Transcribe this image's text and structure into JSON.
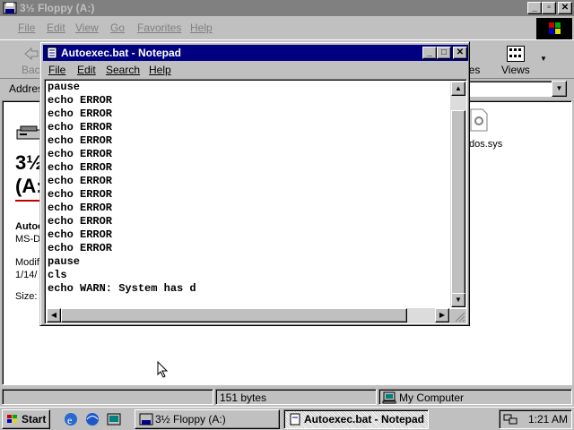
{
  "explorer": {
    "title": "3½ Floppy (A:)",
    "menu": [
      "File",
      "Edit",
      "View",
      "Go",
      "Favorites",
      "Help"
    ],
    "toolbar": {
      "back_label": "Back",
      "partial_label": "ies",
      "views_label": "Views"
    },
    "address_label": "Address",
    "content": {
      "title_line1": "3½ Floppy",
      "title_line2": "(A:)",
      "selected_name": "Autoexec.bat",
      "selected_type": "MS-DOS Batch File",
      "modified_label": "Modified:",
      "modified_value": "1/14/",
      "size_label": "Size:",
      "file_label": "dos.sys"
    },
    "status": {
      "size": "151 bytes",
      "zone": "My Computer"
    }
  },
  "notepad": {
    "title": "Autoexec.bat - Notepad",
    "menu": [
      "File",
      "Edit",
      "Search",
      "Help"
    ],
    "lines": [
      "pause",
      "echo ERROR",
      "echo ERROR",
      "echo ERROR",
      "echo ERROR",
      "echo ERROR",
      "echo ERROR",
      "echo ERROR",
      "echo ERROR",
      "echo ERROR",
      "echo ERROR",
      "echo ERROR",
      "echo ERROR",
      "pause",
      "cls",
      "echo WARN: System has d"
    ]
  },
  "taskbar": {
    "start_label": "Start",
    "tasks": [
      "3½ Floppy (A:)",
      "Autoexec.bat - Notepad"
    ],
    "clock": "1:21 AM"
  },
  "colors": {
    "active_title": "#000080",
    "inactive_title": "#808080",
    "face": "#c0c0c0"
  },
  "icons": [
    "floppy-icon",
    "notepad-icon",
    "back-arrow-icon",
    "views-icon",
    "drive-icon",
    "system-file-icon",
    "mouse-cursor-icon",
    "windows-logo-icon",
    "ie-icon",
    "desktop-icon",
    "channels-icon",
    "tray-network-icon"
  ]
}
